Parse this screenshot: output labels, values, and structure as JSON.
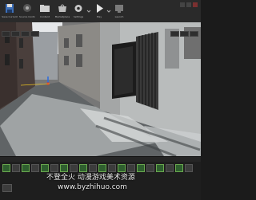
{
  "toolbar": {
    "buttons": [
      {
        "label": "Save Current",
        "icon": "save-icon"
      },
      {
        "label": "Source Control",
        "icon": "source-control-icon"
      },
      {
        "label": "Content",
        "icon": "content-browser-icon"
      },
      {
        "label": "Marketplace",
        "icon": "marketplace-icon"
      },
      {
        "label": "Settings",
        "icon": "gear-icon"
      },
      {
        "label": "Blueprints",
        "icon": "blueprint-icon"
      },
      {
        "label": "Cinematics",
        "icon": "cinematics-icon"
      },
      {
        "label": "Build",
        "icon": "build-icon"
      },
      {
        "label": "Play",
        "icon": "play-icon"
      },
      {
        "label": "Launch",
        "icon": "launch-icon"
      }
    ]
  },
  "watermark": {
    "line1": "不登全火 动漫游戏美术资源",
    "line2": "www.byzhihuo.com"
  },
  "colors": {
    "accent_green": "#6aa84f",
    "play_green": "#7fbf3f",
    "wall_brick": "#8b6a5a"
  }
}
